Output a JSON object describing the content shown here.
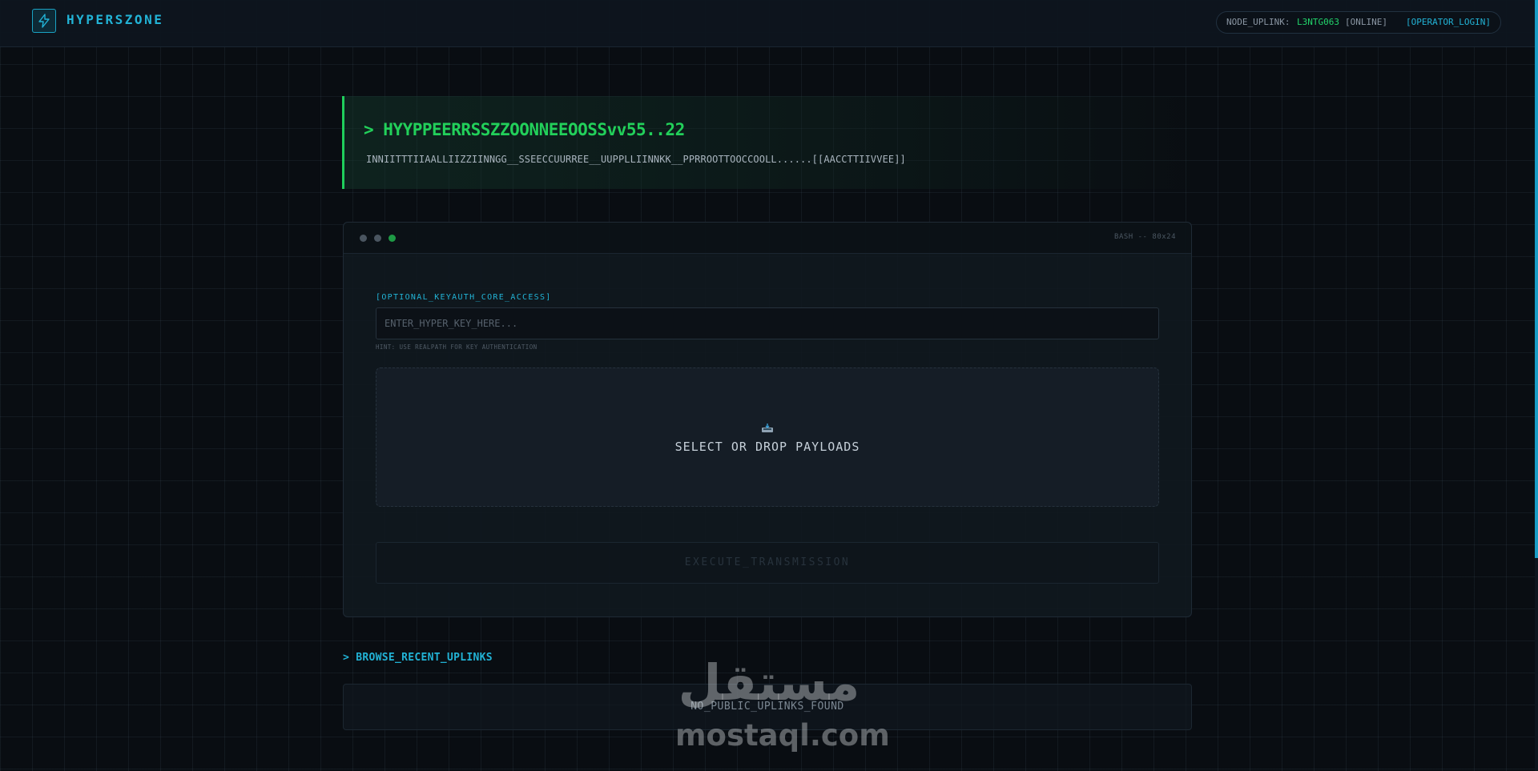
{
  "header": {
    "brand": "HYPERSZONE",
    "logo_icon": "lightning-bolt-icon",
    "status_label": "NODE_UPLINK:",
    "node_id": "L3NTG063",
    "node_state": "[ONLINE]",
    "login_label": "[OPERATOR_LOGIN]"
  },
  "hero": {
    "title": "> HYYPPEERRSSZZOONNEEOOSSvv55..22",
    "subtitle": "INNIITTTIIAALLIIZZIINNGG__SSEECCUURREE__UUPPLLIINNKK__PPRROOTTOOCCOOLL......[[AACCTTIIVVEE]]"
  },
  "terminal": {
    "tag": "BASH -- 80x24",
    "key_label": "[OPTIONAL_KEYAUTH_CORE_ACCESS]",
    "key_placeholder": "ENTER_HYPER_KEY_HERE...",
    "key_value": "",
    "hint": "HINT: USE REALPATH FOR KEY AUTHENTICATION",
    "drop_icon": "inbox-tray-icon",
    "drop_text": "SELECT OR DROP PAYLOADS",
    "execute_label": "EXECUTE_TRANSMISSION"
  },
  "recent": {
    "title": "> BROWSE_RECENT_UPLINKS",
    "empty": "NO_PUBLIC_UPLINKS_FOUND"
  },
  "watermark": {
    "arabic": "مستقل",
    "latin": "mostaql.com"
  },
  "colors": {
    "accent_cyan": "#22b3d6",
    "accent_green": "#22d05a",
    "background": "#090d12"
  }
}
